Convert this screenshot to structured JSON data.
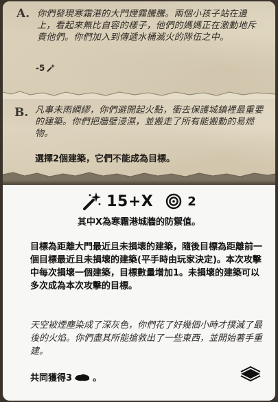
{
  "option_a": {
    "letter": "A.",
    "text": "你們發現寒霜港的大門煙霧騰騰。兩個小孩子站在邊上，看起來無比自容的樣子，他們的媽媽正在激動地斥責他們。你們加入到傳遞水桶滅火的隊伍之中。",
    "effect": "-5",
    "effect_icon": "spark-wand-icon"
  },
  "option_b": {
    "letter": "B.",
    "text": "凡事未雨綢繆，你們避開起火點，衝去保護城鎮裡最重要的建築。你們把牆壁浸濕，並搬走了所有能搬動的易燃物。",
    "instruction": "選擇2個建築，它們不能成為目標。"
  },
  "attack": {
    "icon": "spark-wand-icon",
    "value": "15+X",
    "target_icon": "target-icon",
    "targets": "2",
    "note": "其中X為寒霜港城牆的防禦值。"
  },
  "rules": "目標為距離大門最近且未損壞的建築，隨後目標為距離前一個目標最近且未損壞的建築(平手時由玩家決定)。本次攻擊中每次損壞一個建築，目標數量增加1。未損壞的建築可以多次成為本次攻擊的目標。",
  "flavor": "天空被煙塵染成了深灰色，你們花了好幾個小時才撲滅了最後的火焰。你們盡其所能搶救出了一些東西，並開始著手重建。",
  "reward": {
    "text": "共同獲得3",
    "icon": "material-resource-icon",
    "suffix": "。"
  },
  "deck_icon": "card-deck-icon"
}
